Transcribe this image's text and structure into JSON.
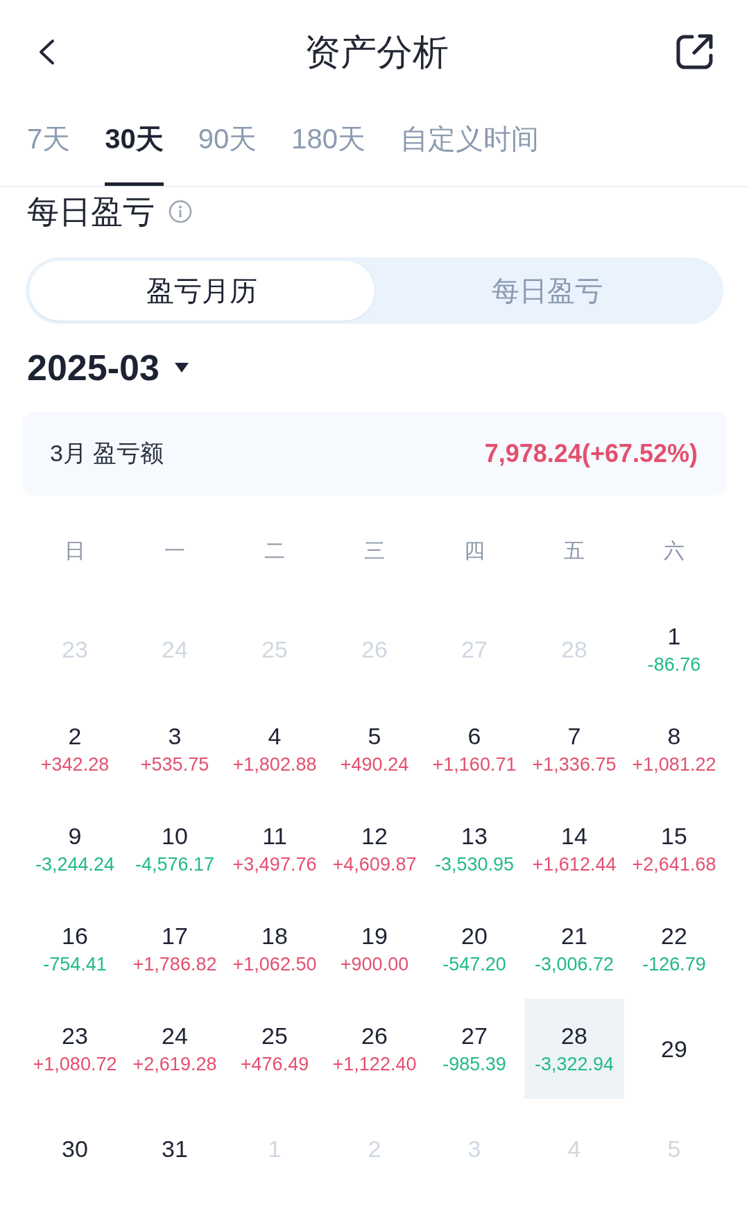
{
  "header": {
    "title": "资产分析"
  },
  "period_tabs": [
    {
      "label": "7天",
      "selected": false
    },
    {
      "label": "30天",
      "selected": true
    },
    {
      "label": "90天",
      "selected": false
    },
    {
      "label": "180天",
      "selected": false
    },
    {
      "label": "自定义时间",
      "selected": false
    }
  ],
  "section": {
    "title": "每日盈亏"
  },
  "view_toggle": [
    {
      "label": "盈亏月历",
      "selected": true
    },
    {
      "label": "每日盈亏",
      "selected": false
    }
  ],
  "month_picker": {
    "value": "2025-03"
  },
  "summary": {
    "label": "3月 盈亏额",
    "value": "7,978.24(+67.52%)",
    "color": "#e3506f"
  },
  "calendar": {
    "weekdays": [
      "日",
      "一",
      "二",
      "三",
      "四",
      "五",
      "六"
    ],
    "days": [
      {
        "day": "23",
        "in_month": false,
        "selected": false
      },
      {
        "day": "24",
        "in_month": false,
        "selected": false
      },
      {
        "day": "25",
        "in_month": false,
        "selected": false
      },
      {
        "day": "26",
        "in_month": false,
        "selected": false
      },
      {
        "day": "27",
        "in_month": false,
        "selected": false
      },
      {
        "day": "28",
        "in_month": false,
        "selected": false
      },
      {
        "day": "1",
        "in_month": true,
        "selected": false,
        "change": "-86.76",
        "color": "#21b98a"
      },
      {
        "day": "2",
        "in_month": true,
        "selected": false,
        "change": "+342.28",
        "color": "#e3506f"
      },
      {
        "day": "3",
        "in_month": true,
        "selected": false,
        "change": "+535.75",
        "color": "#e3506f"
      },
      {
        "day": "4",
        "in_month": true,
        "selected": false,
        "change": "+1,802.88",
        "color": "#e3506f"
      },
      {
        "day": "5",
        "in_month": true,
        "selected": false,
        "change": "+490.24",
        "color": "#e3506f"
      },
      {
        "day": "6",
        "in_month": true,
        "selected": false,
        "change": "+1,160.71",
        "color": "#e3506f"
      },
      {
        "day": "7",
        "in_month": true,
        "selected": false,
        "change": "+1,336.75",
        "color": "#e3506f"
      },
      {
        "day": "8",
        "in_month": true,
        "selected": false,
        "change": "+1,081.22",
        "color": "#e3506f"
      },
      {
        "day": "9",
        "in_month": true,
        "selected": false,
        "change": "-3,244.24",
        "color": "#21b98a"
      },
      {
        "day": "10",
        "in_month": true,
        "selected": false,
        "change": "-4,576.17",
        "color": "#21b98a"
      },
      {
        "day": "11",
        "in_month": true,
        "selected": false,
        "change": "+3,497.76",
        "color": "#e3506f"
      },
      {
        "day": "12",
        "in_month": true,
        "selected": false,
        "change": "+4,609.87",
        "color": "#e3506f"
      },
      {
        "day": "13",
        "in_month": true,
        "selected": false,
        "change": "-3,530.95",
        "color": "#21b98a"
      },
      {
        "day": "14",
        "in_month": true,
        "selected": false,
        "change": "+1,612.44",
        "color": "#e3506f"
      },
      {
        "day": "15",
        "in_month": true,
        "selected": false,
        "change": "+2,641.68",
        "color": "#e3506f"
      },
      {
        "day": "16",
        "in_month": true,
        "selected": false,
        "change": "-754.41",
        "color": "#21b98a"
      },
      {
        "day": "17",
        "in_month": true,
        "selected": false,
        "change": "+1,786.82",
        "color": "#e3506f"
      },
      {
        "day": "18",
        "in_month": true,
        "selected": false,
        "change": "+1,062.50",
        "color": "#e3506f"
      },
      {
        "day": "19",
        "in_month": true,
        "selected": false,
        "change": "+900.00",
        "color": "#e3506f"
      },
      {
        "day": "20",
        "in_month": true,
        "selected": false,
        "change": "-547.20",
        "color": "#21b98a"
      },
      {
        "day": "21",
        "in_month": true,
        "selected": false,
        "change": "-3,006.72",
        "color": "#21b98a"
      },
      {
        "day": "22",
        "in_month": true,
        "selected": false,
        "change": "-126.79",
        "color": "#21b98a"
      },
      {
        "day": "23",
        "in_month": true,
        "selected": false,
        "change": "+1,080.72",
        "color": "#e3506f"
      },
      {
        "day": "24",
        "in_month": true,
        "selected": false,
        "change": "+2,619.28",
        "color": "#e3506f"
      },
      {
        "day": "25",
        "in_month": true,
        "selected": false,
        "change": "+476.49",
        "color": "#e3506f"
      },
      {
        "day": "26",
        "in_month": true,
        "selected": false,
        "change": "+1,122.40",
        "color": "#e3506f"
      },
      {
        "day": "27",
        "in_month": true,
        "selected": false,
        "change": "-985.39",
        "color": "#21b98a"
      },
      {
        "day": "28",
        "in_month": true,
        "selected": true,
        "change": "-3,322.94",
        "color": "#21b98a"
      },
      {
        "day": "29",
        "in_month": true,
        "selected": false
      },
      {
        "day": "30",
        "in_month": true,
        "selected": false
      },
      {
        "day": "31",
        "in_month": true,
        "selected": false
      },
      {
        "day": "1",
        "in_month": false,
        "selected": false
      },
      {
        "day": "2",
        "in_month": false,
        "selected": false
      },
      {
        "day": "3",
        "in_month": false,
        "selected": false
      },
      {
        "day": "4",
        "in_month": false,
        "selected": false
      },
      {
        "day": "5",
        "in_month": false,
        "selected": false
      }
    ]
  }
}
